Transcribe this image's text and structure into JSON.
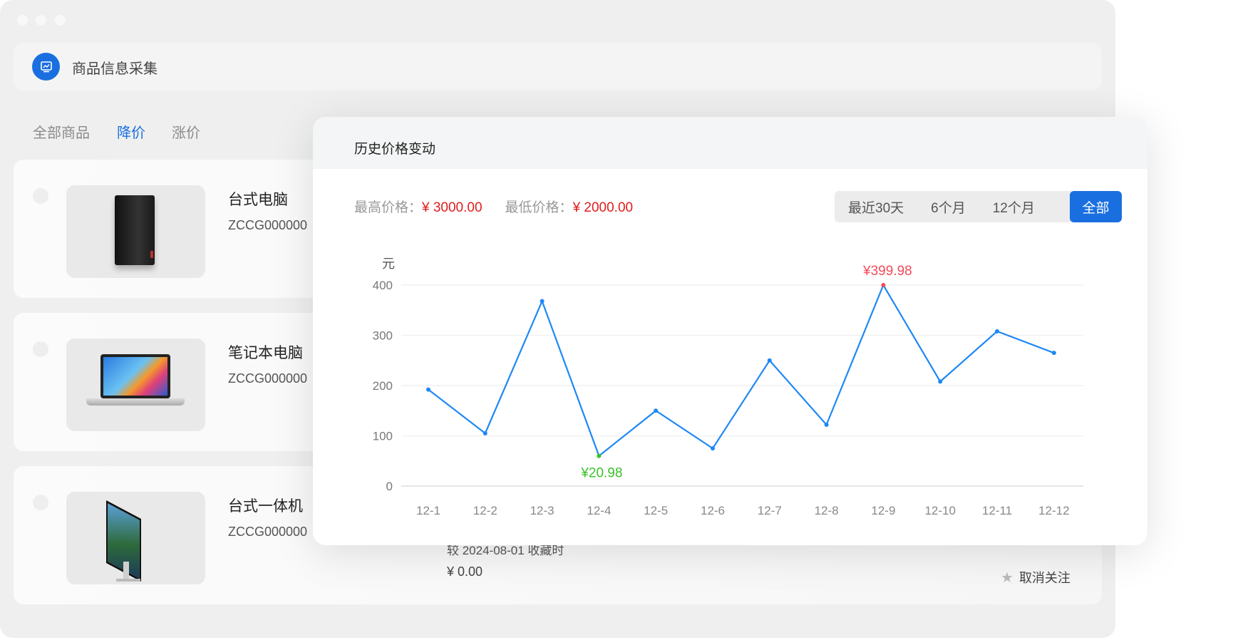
{
  "app": {
    "title": "商品信息采集",
    "icon": "chart-monitor-icon"
  },
  "tabs": [
    {
      "label": "全部商品"
    },
    {
      "label": "降价"
    },
    {
      "label": "涨价"
    }
  ],
  "products": [
    {
      "name": "台式电脑",
      "code": "ZCCG000000"
    },
    {
      "name": "笔记本电脑",
      "code": "ZCCG000000"
    },
    {
      "name": "台式一体机",
      "code": "ZCCG000000",
      "note": "较 2024-08-01 收藏时",
      "price": "¥ 0.00",
      "unfollow": "取消关注"
    }
  ],
  "modal": {
    "title": "历史价格变动",
    "max_label": "最高价格：",
    "max_value": "¥ 3000.00",
    "min_label": "最低价格：",
    "min_value": "¥ 2000.00",
    "ranges": [
      "最近30天",
      "6个月",
      "12个月",
      "全部"
    ],
    "active_range": "全部"
  },
  "colors": {
    "accent": "#1a6fe0",
    "line": "#1e88f5",
    "max": "#f04b5b",
    "min": "#3bc22a",
    "price": "#e01d1d"
  },
  "chart_data": {
    "type": "line",
    "ylabel": "元",
    "ylim": [
      0,
      400
    ],
    "yticks": [
      "0",
      "100",
      "200",
      "300",
      "400"
    ],
    "categories": [
      "12-1",
      "12-2",
      "12-3",
      "12-4",
      "12-5",
      "12-6",
      "12-7",
      "12-8",
      "12-9",
      "12-10",
      "12-11",
      "12-12"
    ],
    "values": [
      192,
      105,
      368,
      60,
      150,
      75,
      250,
      122,
      399.98,
      208,
      308,
      265
    ],
    "max_label": "¥399.98",
    "max_index": 8,
    "min_label": "¥20.98",
    "min_index": 3,
    "grid": true
  }
}
